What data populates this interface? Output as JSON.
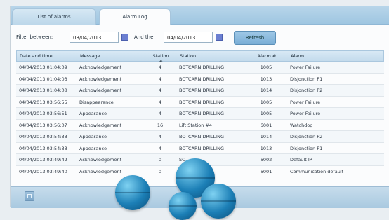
{
  "tabs": {
    "list_of_alarms": "List of alarms",
    "alarm_log": "Alarm Log"
  },
  "filter": {
    "between_label": "Filter between:",
    "from_date": "03/04/2013",
    "and_label": "And the:",
    "to_date": "04/04/2013",
    "refresh_label": "Refresh"
  },
  "table": {
    "headers": [
      "Date and time",
      "Message",
      "Station #",
      "Station",
      "Alarm #",
      "Alarm"
    ],
    "rows": [
      [
        "04/04/2013 01:04:09",
        "Acknowledgement",
        "4",
        "BOTCARN DRILLING",
        "1005",
        "Power Failure"
      ],
      [
        "04/04/2013 01:04:03",
        "Acknowledgement",
        "4",
        "BOTCARN DRILLING",
        "1013",
        "Disjonction P1"
      ],
      [
        "04/04/2013 01:04:08",
        "Acknowledgement",
        "4",
        "BOTCARN DRILLING",
        "1014",
        "Disjonction P2"
      ],
      [
        "04/04/2013 03:56:55",
        "Disappearance",
        "4",
        "BOTCARN DRILLING",
        "1005",
        "Power Failure"
      ],
      [
        "04/04/2013 03:56:51",
        "Appearance",
        "4",
        "BOTCARN DRILLING",
        "1005",
        "Power Failure"
      ],
      [
        "04/04/2013 03:56:07",
        "Acknowledgement",
        "16",
        "Lift Station #4",
        "6001",
        "Watchdog"
      ],
      [
        "04/04/2013 03:54:33",
        "Appearance",
        "4",
        "BOTCARN DRILLING",
        "1014",
        "Disjonction P2"
      ],
      [
        "04/04/2013 03:54:33",
        "Appearance",
        "4",
        "BOTCARN DRILLING",
        "1013",
        "Disjonction P1"
      ],
      [
        "04/04/2013 03:49:42",
        "Acknowledgement",
        "0",
        "SC",
        "6002",
        "Default IP"
      ],
      [
        "04/04/2013 03:49:40",
        "Acknowledgement",
        "0",
        "S",
        "6001",
        "Communication default"
      ]
    ]
  }
}
